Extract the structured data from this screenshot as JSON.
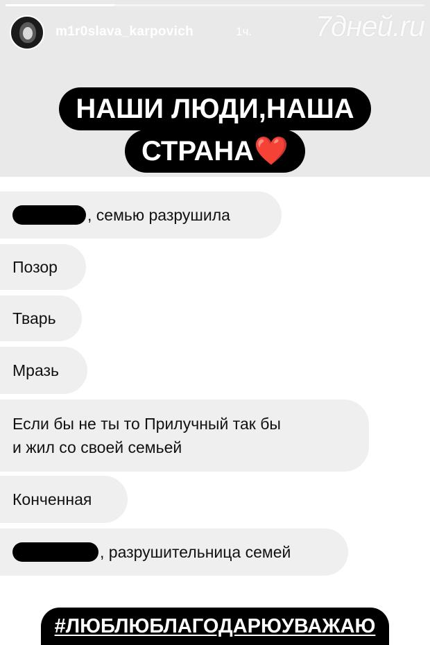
{
  "story": {
    "progress": 0.26,
    "username": "m1r0slava_karpovich",
    "time": "1ч.",
    "watermark": "7дней.ru",
    "headline": {
      "line1": "НАШИ ЛЮДИ,НАША",
      "line2": "СТРАНА",
      "emoji": "❤️"
    },
    "messages": [
      {
        "text": ", семью разрушила",
        "censored": true
      },
      {
        "text": "Позор"
      },
      {
        "text": "Тварь"
      },
      {
        "text": "Мразь"
      },
      {
        "line1": "Если бы не ты то Прилучный так бы",
        "line2": "и жил со своей семьей"
      },
      {
        "text": "Конченная"
      },
      {
        "text": ", разрушительница семей",
        "censored": true
      }
    ],
    "hashtag": "#ЛЮБЛЮБЛАГОДАРЮУВАЖАЮ"
  }
}
